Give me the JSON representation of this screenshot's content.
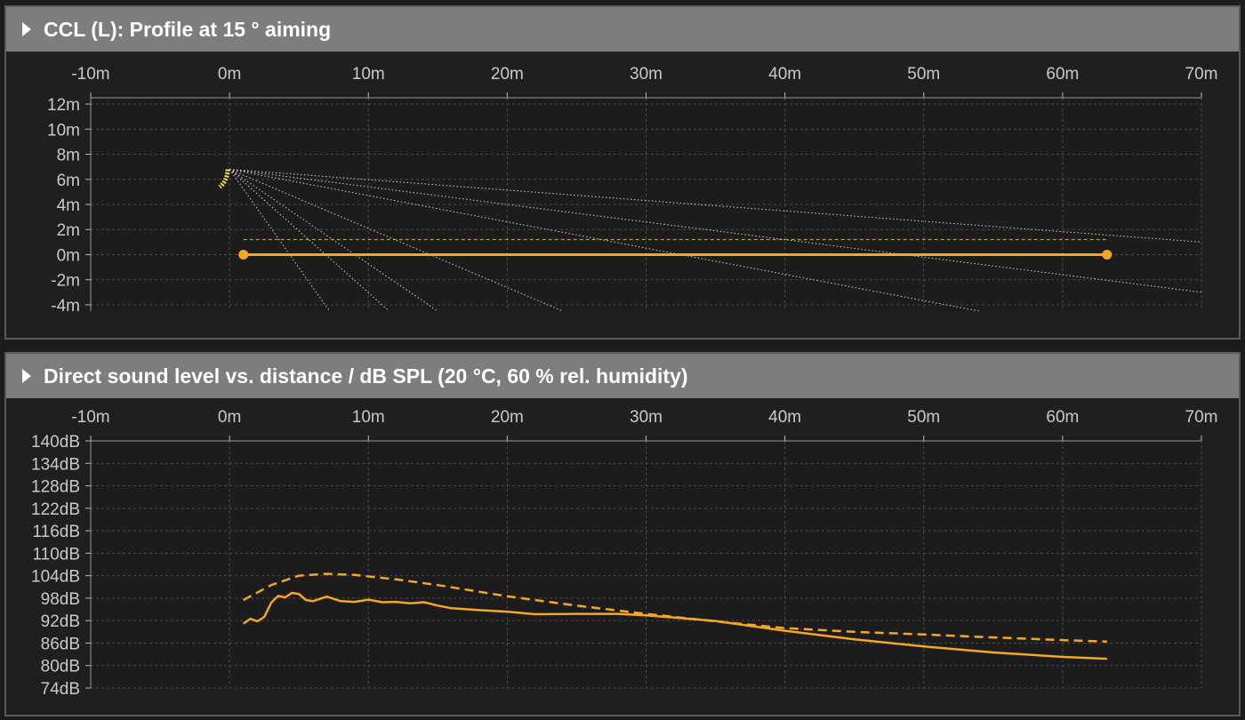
{
  "panels": [
    {
      "title": "CCL (L): Profile at 15 ° aiming",
      "chart_data": {
        "type": "line",
        "x_ticks": [
          "-10m",
          "0m",
          "10m",
          "20m",
          "30m",
          "40m",
          "50m",
          "60m",
          "70m"
        ],
        "y_ticks": [
          "12m",
          "10m",
          "8m",
          "6m",
          "4m",
          "2m",
          "0m",
          "-2m",
          "-4m"
        ],
        "xlim": [
          -10,
          70
        ],
        "ylim": [
          -4.5,
          12.5
        ],
        "grid": true,
        "source": {
          "x_start": 0,
          "y_top": 6.8,
          "y_bottom": 5.4
        },
        "rays": [
          {
            "x": 70,
            "y": 1.0
          },
          {
            "x": 70,
            "y": -3.0
          },
          {
            "x": 54,
            "y": -4.5
          },
          {
            "x": 24,
            "y": -4.5
          },
          {
            "x": 15,
            "y": -4.5
          },
          {
            "x": 11.5,
            "y": -4.5
          },
          {
            "x": 7.2,
            "y": -4.5
          }
        ],
        "listener_line": {
          "x": [
            1,
            63.2
          ],
          "y": 0
        },
        "reference_line": {
          "x": [
            1,
            63.2
          ],
          "y": 1.2
        },
        "color": "#f5a623"
      }
    },
    {
      "title": "Direct sound level vs. distance / dB SPL (20 °C, 60 % rel. humidity)",
      "chart_data": {
        "type": "line",
        "x_ticks": [
          "-10m",
          "0m",
          "10m",
          "20m",
          "30m",
          "40m",
          "50m",
          "60m",
          "70m"
        ],
        "y_ticks": [
          "140dB",
          "134dB",
          "128dB",
          "122dB",
          "116dB",
          "110dB",
          "104dB",
          "98dB",
          "92dB",
          "86dB",
          "80dB",
          "74dB"
        ],
        "xlim": [
          -10,
          70
        ],
        "ylim": [
          74,
          140
        ],
        "grid": true,
        "color": "#f5a623",
        "series": [
          {
            "style": "dashed",
            "x": [
              1,
              3,
              5,
              7,
              9,
              12,
              15,
              20,
              25,
              30,
              35,
              40,
              45,
              50,
              55,
              60,
              63.2
            ],
            "y": [
              97.5,
              101.5,
              104.0,
              104.5,
              104.2,
              103.0,
              101.5,
              98.5,
              96.0,
              93.8,
              91.8,
              90.0,
              89.0,
              88.3,
              87.5,
              86.8,
              86.4
            ]
          },
          {
            "style": "solid",
            "x": [
              1,
              1.5,
              2.0,
              2.5,
              3.0,
              3.5,
              4.0,
              4.5,
              5.0,
              5.5,
              6.0,
              7.0,
              8.0,
              9.0,
              10.0,
              11.0,
              12.0,
              13.0,
              14.0,
              15.0,
              16.0,
              18.0,
              20.0,
              22.0,
              25.0,
              28.0,
              30.0,
              32.0,
              35.0,
              40.0,
              45.0,
              50.0,
              55.0,
              60.0,
              63.2
            ],
            "y": [
              91.2,
              92.5,
              91.8,
              93.0,
              96.8,
              98.6,
              98.2,
              99.4,
              99.1,
              97.5,
              97.2,
              98.4,
              97.2,
              97.0,
              97.6,
              96.9,
              97.0,
              96.6,
              96.9,
              96.0,
              95.3,
              94.8,
              94.4,
              93.7,
              93.8,
              93.8,
              93.4,
              92.8,
              91.9,
              89.3,
              87.0,
              85.1,
              83.5,
              82.3,
              81.8
            ]
          }
        ]
      }
    }
  ]
}
